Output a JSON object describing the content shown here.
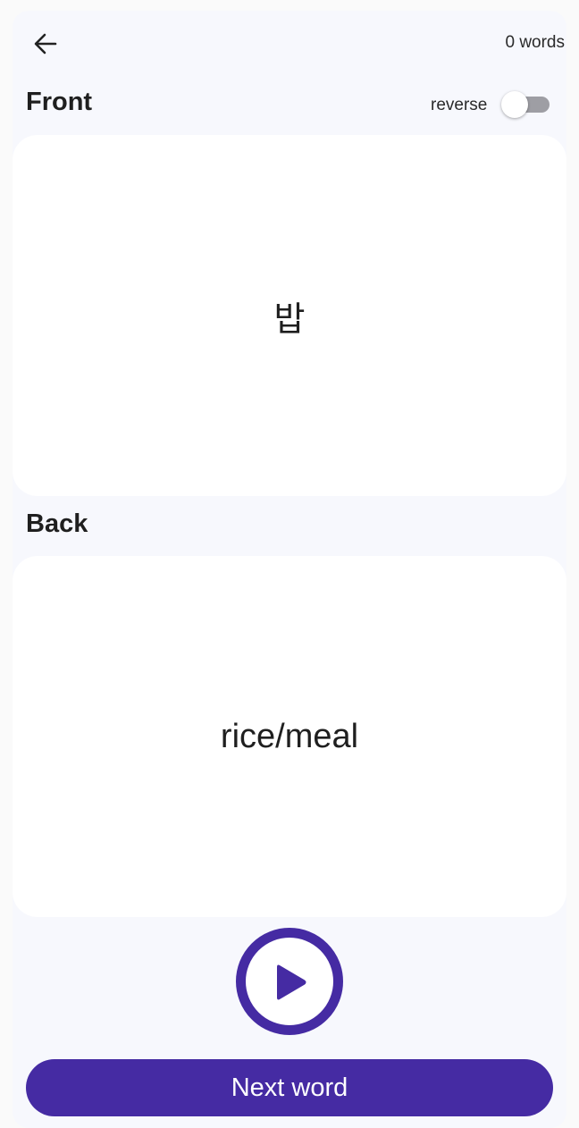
{
  "header": {
    "back_icon": "arrow-left-icon",
    "word_count": "0 words"
  },
  "front": {
    "label": "Front",
    "reverse_label": "reverse",
    "reverse_on": false,
    "text": "밥"
  },
  "back": {
    "label": "Back",
    "text": "rice/meal"
  },
  "controls": {
    "play_icon": "play-icon",
    "next_label": "Next word"
  },
  "colors": {
    "accent": "#452ba3",
    "background": "#f7f8fd",
    "card": "#ffffff"
  }
}
